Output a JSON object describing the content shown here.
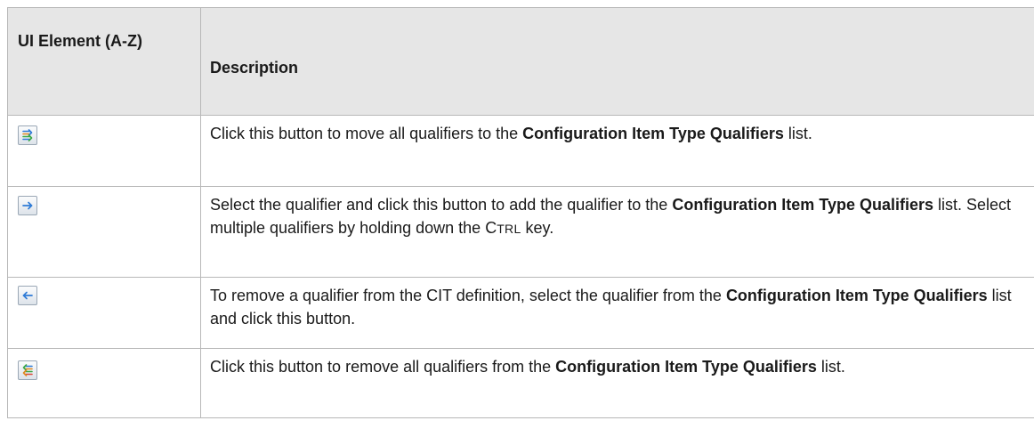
{
  "table": {
    "header": {
      "col1": "UI Element (A-Z)",
      "col2": "Description"
    },
    "rows": [
      {
        "icon": "move-all-right-icon",
        "text_1": "Click this button to move all qualifiers to the ",
        "bold_1": "Configuration Item Type Qualifiers",
        "text_2": " list."
      },
      {
        "icon": "move-right-arrow-icon",
        "text_1": "Select the qualifier and click this button to add the qualifier to the ",
        "bold_1": "Configuration Item Type Qualifiers",
        "text_2": " list. Select multiple qualifiers by holding down the ",
        "key_first": "C",
        "key_rest": "TRL",
        "text_3": " key."
      },
      {
        "icon": "move-left-arrow-icon",
        "text_1": "To remove a qualifier from the CIT definition, select the qualifier from the ",
        "bold_1": "Configuration Item Type Qualifiers",
        "text_2": " list and click this button."
      },
      {
        "icon": "move-all-left-icon",
        "text_1": "Click this button to remove all qualifiers from the ",
        "bold_1": "Configuration Item Type Qualifiers",
        "text_2": " list."
      }
    ]
  }
}
